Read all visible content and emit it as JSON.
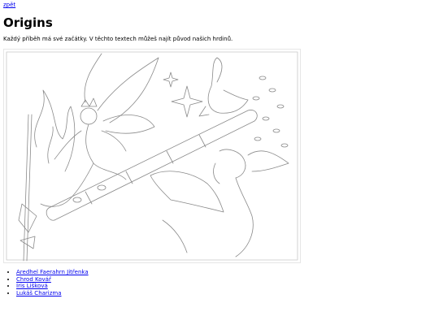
{
  "nav": {
    "back_label": "zpět"
  },
  "page": {
    "title": "Origins",
    "intro": "Každý příběh má své začátky. V těchto textech můžeš najít původ našich hrdinů."
  },
  "illustration": {
    "kind": "pencil-sketch"
  },
  "characters": [
    {
      "label": "Aredhel Faerahrn Jitřenka"
    },
    {
      "label": "Chrod Kovář"
    },
    {
      "label": "Iris Lišková"
    },
    {
      "label": "Lukáš Charizma"
    }
  ],
  "colors": {
    "link": "#0000ee",
    "sketch_stroke": "#8a8a8a"
  }
}
